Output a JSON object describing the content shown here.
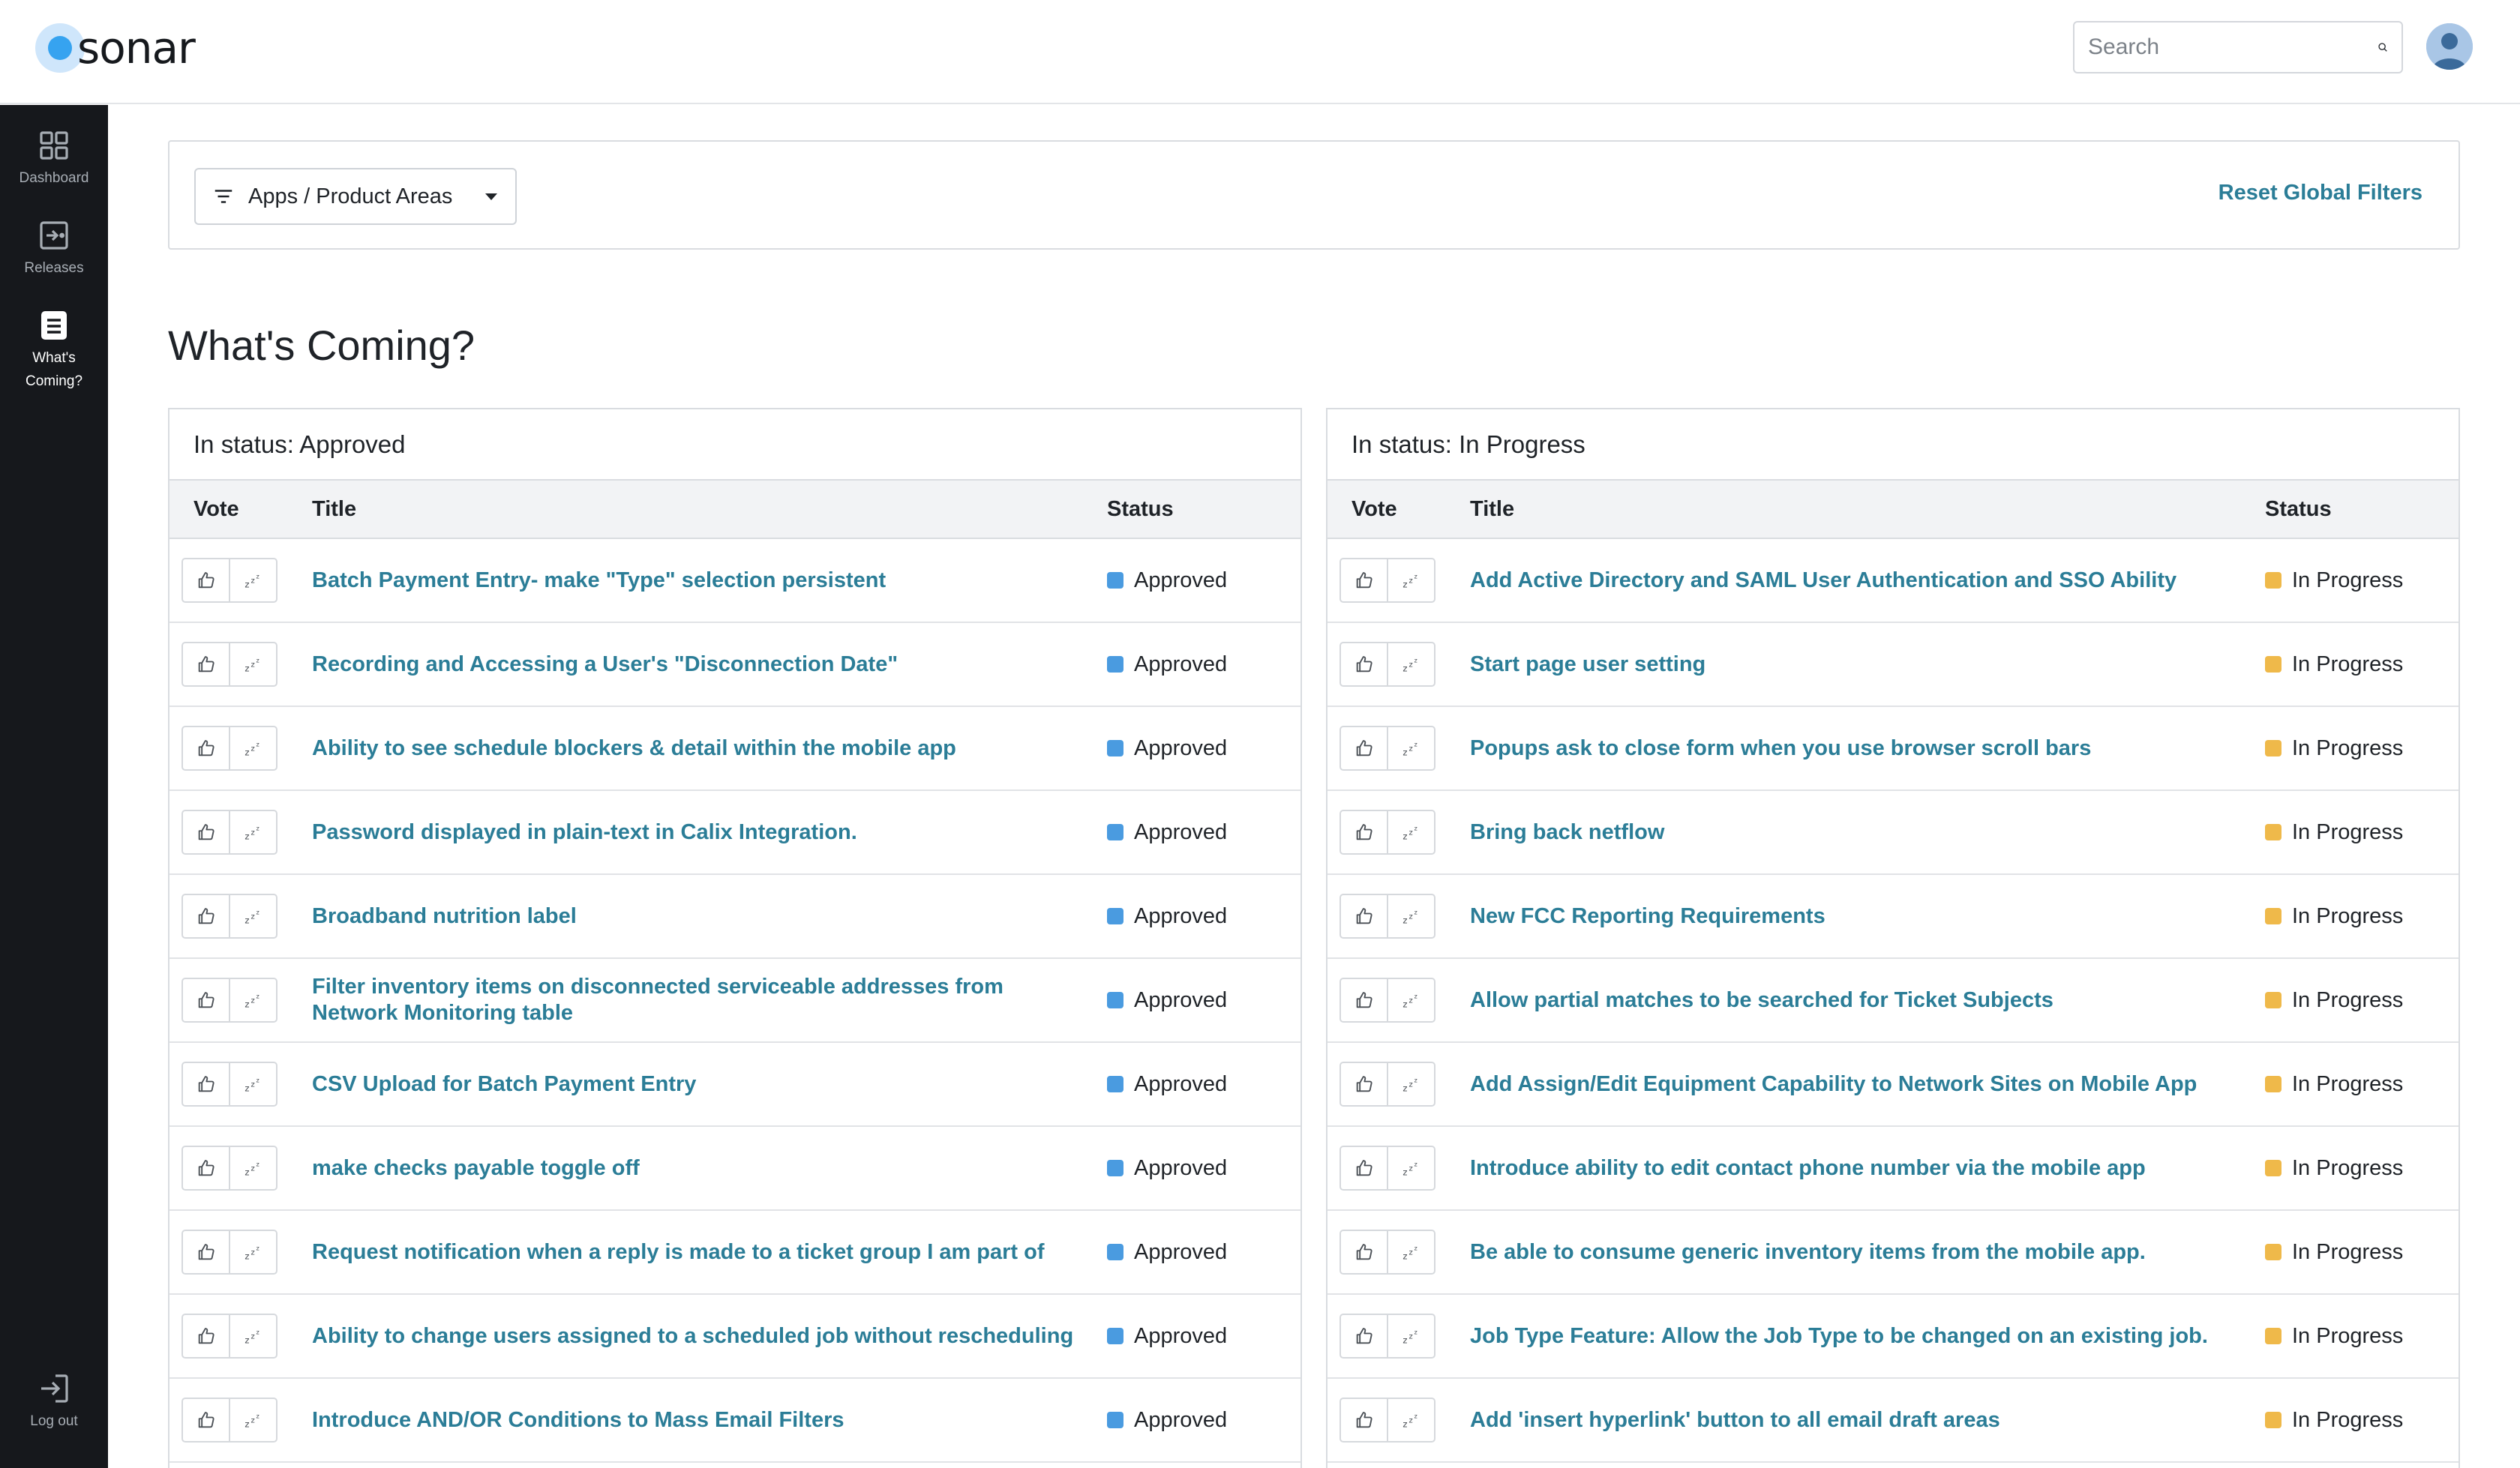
{
  "app": {
    "logo_text": "sonar",
    "search_placeholder": "Search"
  },
  "sidebar": {
    "items": [
      {
        "label": "Dashboard",
        "icon": "grid-icon",
        "active": false
      },
      {
        "label": "Releases",
        "icon": "release-icon",
        "active": false
      },
      {
        "label": "What's Coming?",
        "icon": "document-icon",
        "active": true
      }
    ],
    "logout_label": "Log out"
  },
  "filters": {
    "dropdown_label": "Apps / Product Areas",
    "reset_label": "Reset Global Filters"
  },
  "page_title": "What's Coming?",
  "columns": {
    "vote": "Vote",
    "title": "Title",
    "status": "Status"
  },
  "colors": {
    "accent": "#2b7d97",
    "approved": "#4a9be0",
    "in_progress": "#efb94a"
  },
  "panels": [
    {
      "header": "In status: Approved",
      "status_label": "Approved",
      "rows": [
        "Batch Payment Entry- make \"Type\" selection persistent",
        "Recording and Accessing a User's \"Disconnection Date\"",
        "Ability to see schedule blockers & detail within the mobile app",
        "Password displayed in plain-text in Calix Integration.",
        "Broadband nutrition label",
        "Filter inventory items on disconnected serviceable addresses from Network Monitoring table",
        "CSV Upload for Batch Payment Entry",
        "make checks payable toggle off",
        "Request notification when a reply is made to a ticket group I am part of",
        "Ability to change users assigned to a scheduled job without rescheduling",
        "Introduce AND/OR Conditions to Mass Email Filters"
      ]
    },
    {
      "header": "In status: In Progress",
      "status_label": "In Progress",
      "rows": [
        "Add Active Directory and SAML User Authentication and SSO Ability",
        "Start page user setting",
        "Popups ask to close form when you use browser scroll bars",
        "Bring back netflow",
        "New FCC Reporting Requirements",
        "Allow partial matches to be searched for Ticket Subjects",
        "Add Assign/Edit Equipment Capability to Network Sites on Mobile App",
        "Introduce ability to edit contact phone number via the mobile app",
        "Be able to consume generic inventory items from the mobile app.",
        "Job Type Feature: Allow the Job Type to be changed on an existing job.",
        "Add 'insert hyperlink' button to all email draft areas"
      ]
    }
  ]
}
